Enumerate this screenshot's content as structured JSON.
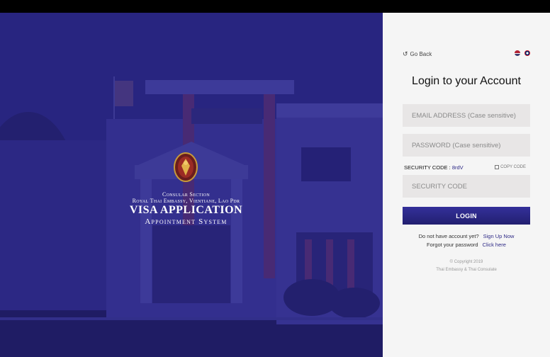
{
  "hero": {
    "brand_line1": "Consular Section",
    "brand_line2": "Royal Thai Embassy, Vientiane, Lao Pdr",
    "brand_line3": "VISA APPLICATION",
    "brand_line4": "Appointment System",
    "overlay_color": "#27237d"
  },
  "panel": {
    "go_back": "Go Back",
    "title": "Login to your Account",
    "email_placeholder": "EMAIL ADDRESS (Case sensitive)",
    "password_placeholder": "PASSWORD (Case sensitive)",
    "security_label": "SECURITY CODE :",
    "security_code": "8rdV",
    "copy_code": "COPY CODE",
    "security_placeholder": "SECURITY CODE",
    "login_label": "LOGIN",
    "no_account_text": "Do not have account yet?",
    "sign_up_link": "Sign Up Now",
    "forgot_text": "Forgot your password",
    "click_here_link": "Click here",
    "copyright": "© Copyright 2019",
    "footer": "Thai Embassy & Thai Consulate",
    "flags": [
      "us-flag-icon",
      "laos-flag-icon"
    ]
  },
  "colors": {
    "accent": "#2e2a86",
    "panel_bg": "#f5f5f5",
    "field_bg": "#e8e6e6"
  }
}
